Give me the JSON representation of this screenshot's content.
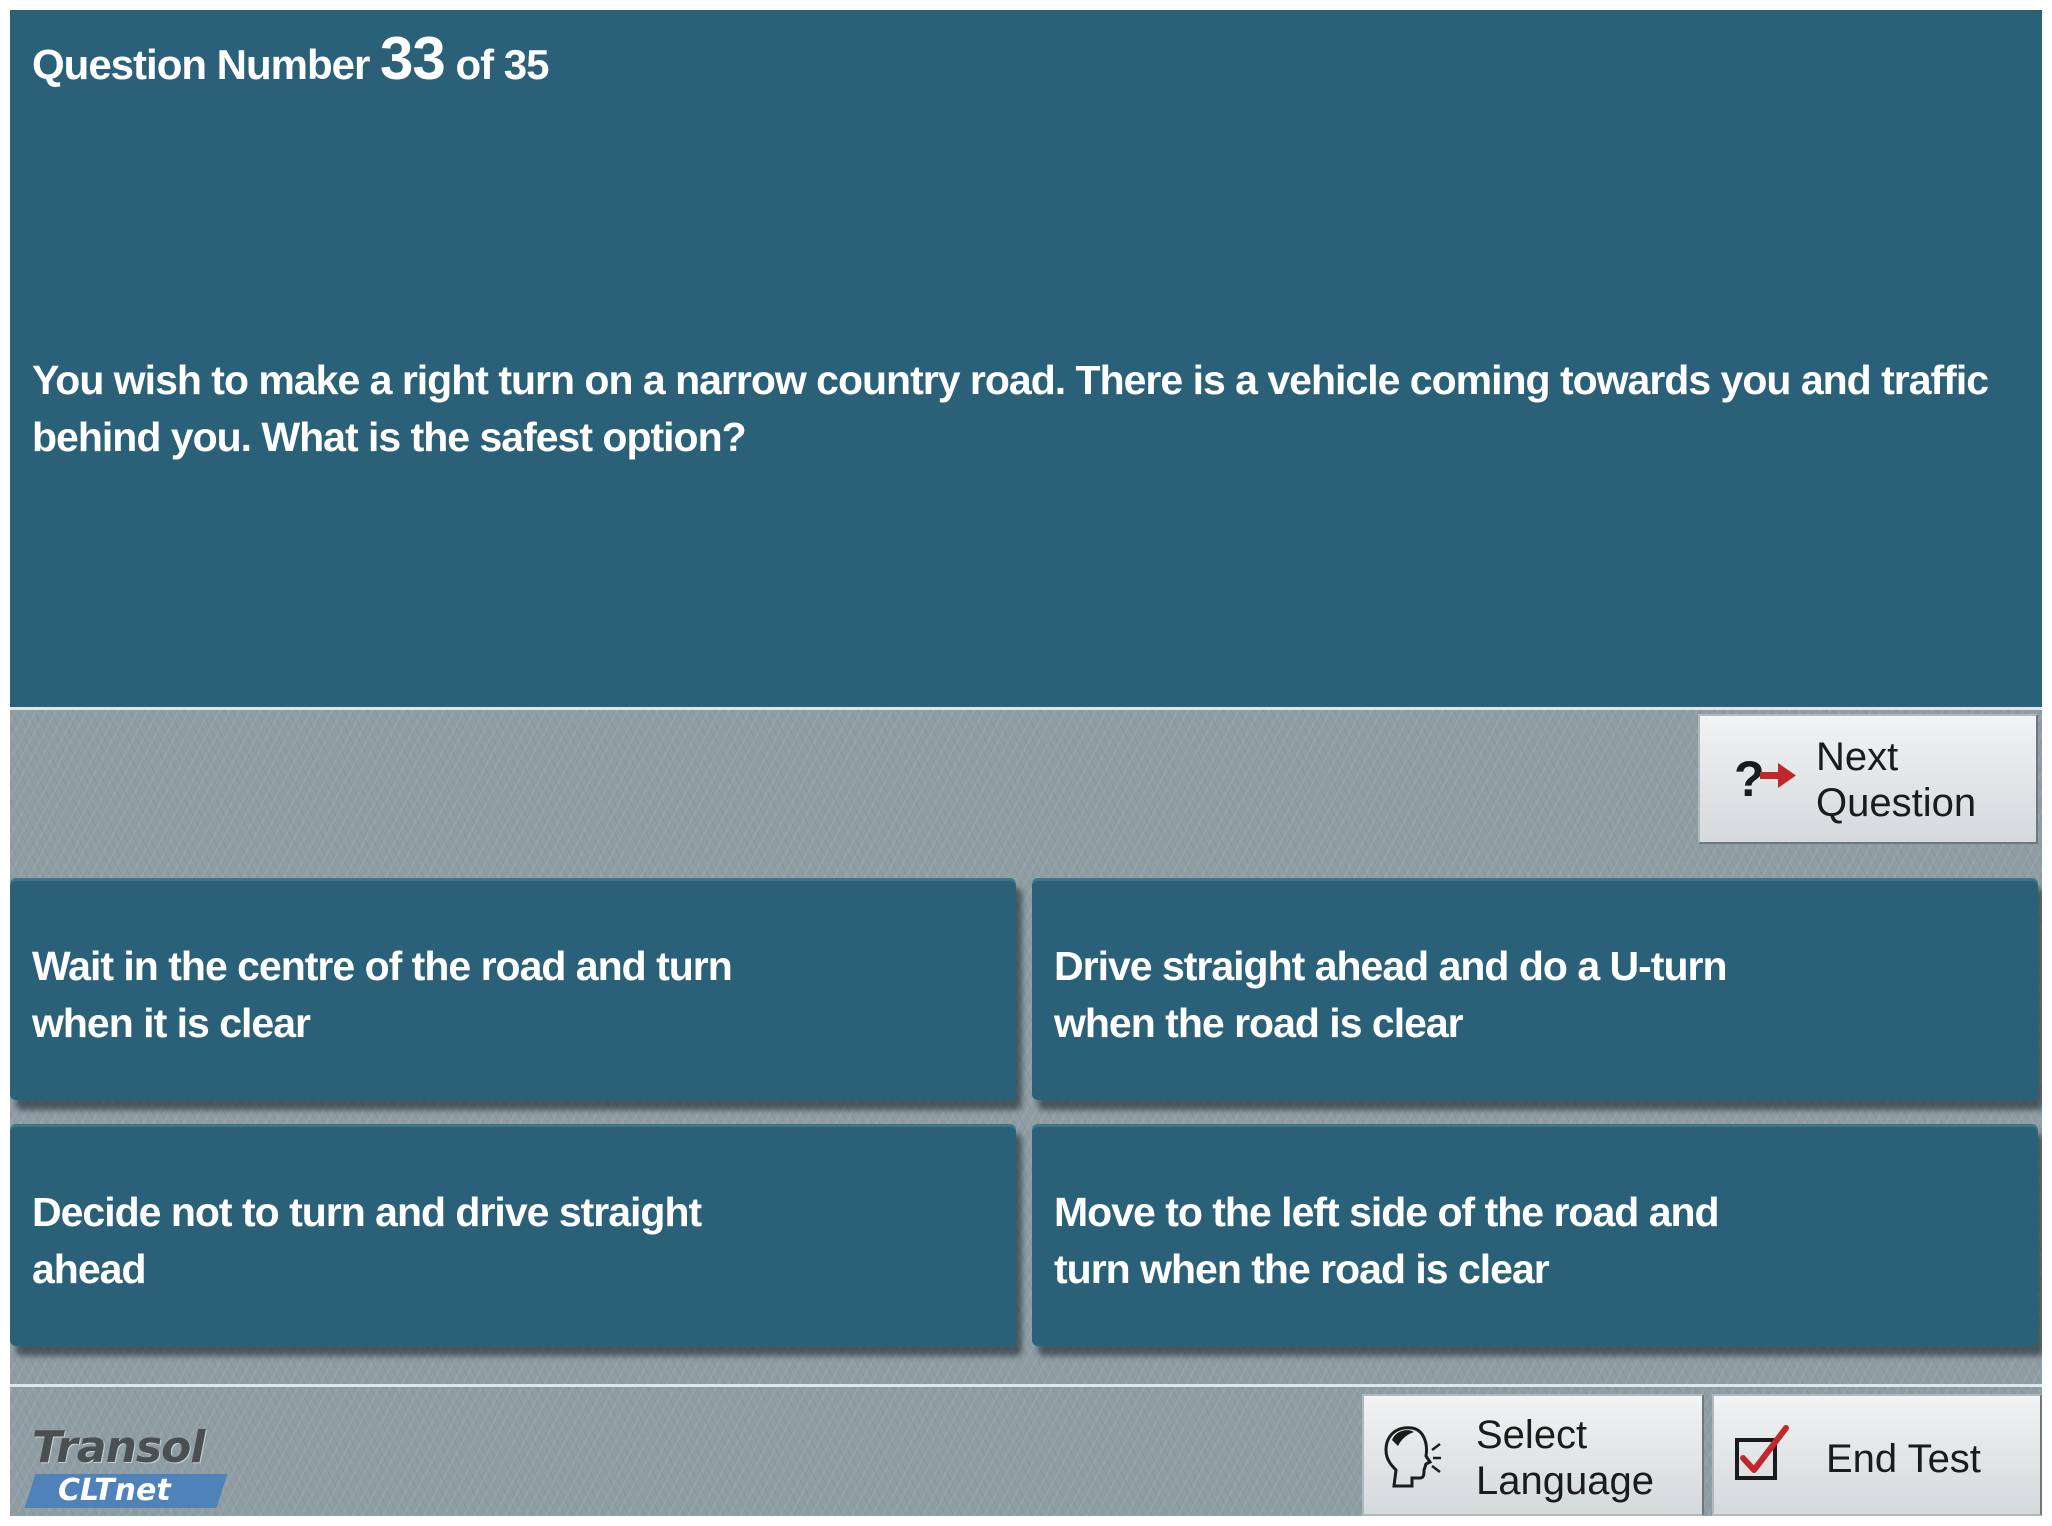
{
  "header": {
    "prefix": "Question Number",
    "current": "33",
    "of_label": "of",
    "total": "35"
  },
  "question": {
    "text": "You wish to make a right turn on a narrow country road. There is a vehicle coming towards you and traffic behind you. What is the safest option?"
  },
  "next_button": {
    "line1": "Next",
    "line2": "Question",
    "icon": "question-arrow-icon"
  },
  "answers": [
    {
      "line1": "Wait in the centre of the road and turn",
      "line2": "when it is clear"
    },
    {
      "line1": "Drive straight ahead and do a U-turn",
      "line2": "when the road is clear"
    },
    {
      "line1": "Decide not to turn and drive straight",
      "line2": "ahead"
    },
    {
      "line1": "Move to the left side of the road and",
      "line2": "turn when the road is clear"
    }
  ],
  "footer": {
    "logo_brand": "Transol",
    "logo_sub": "CLTnet",
    "select_language": {
      "line1": "Select",
      "line2": "Language",
      "icon": "speaking-head-icon"
    },
    "end_test": {
      "label": "End Test",
      "icon": "checkbox-checked-icon"
    }
  },
  "colors": {
    "panel": "#2b6178",
    "background": "#8f9ea4",
    "button_face": "#e6eaeb",
    "accent_red": "#c0282d",
    "logo_blue": "#4f82b8"
  }
}
